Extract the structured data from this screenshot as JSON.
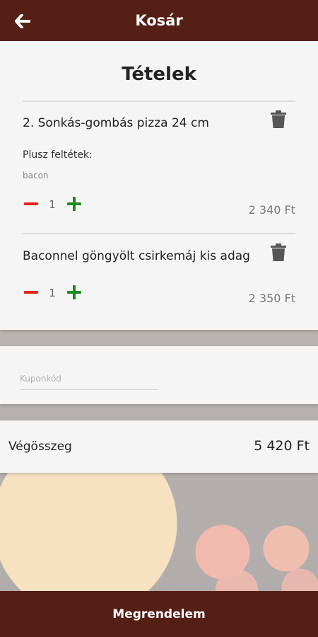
{
  "header": {
    "title": "Kosár",
    "back_icon": "arrow-left-icon"
  },
  "items_section": {
    "title": "Tételek",
    "items": [
      {
        "name": "2. Sonkás-gombás pizza 24 cm",
        "extras_label": "Plusz feltétek:",
        "extras_value": "bacon",
        "quantity": "1",
        "price": "2 340 Ft"
      },
      {
        "name": "Baconnel göngyölt csirkemáj kis adag",
        "quantity": "1",
        "price": "2 350 Ft"
      }
    ]
  },
  "coupon": {
    "placeholder": "Kuponkód",
    "value": ""
  },
  "total": {
    "label": "Végösszeg",
    "value": "5 420 Ft"
  },
  "footer": {
    "order_label": "Megrendelem"
  },
  "colors": {
    "bar": "#561f16",
    "minus": "#e1231a",
    "plus": "#1d8a1d",
    "card": "#f5f5f5"
  }
}
